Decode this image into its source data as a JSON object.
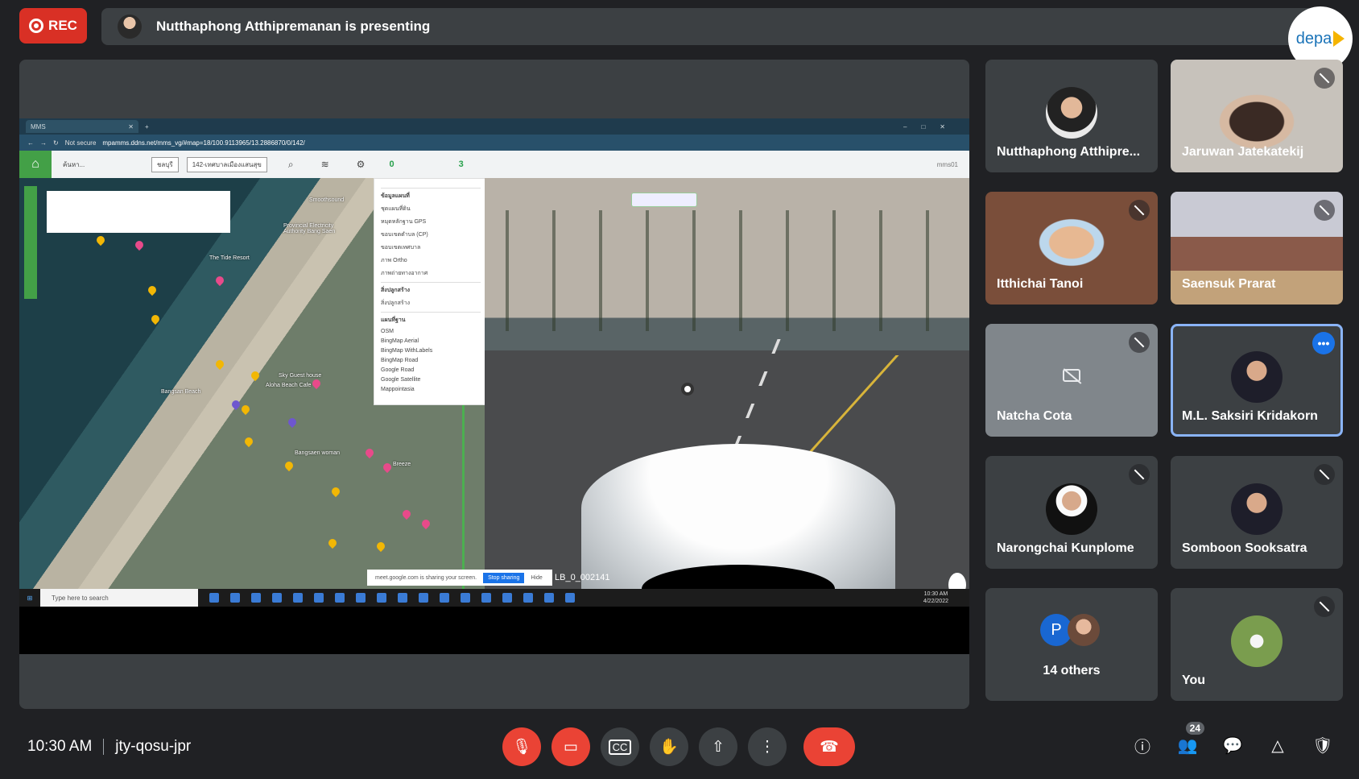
{
  "recording": {
    "label": "REC"
  },
  "presenter_banner": {
    "text": "Nutthaphong Atthipremanan is presenting"
  },
  "logo": {
    "text": "depa"
  },
  "shared_screen": {
    "browser": {
      "tab_title": "MMS",
      "url_prefix": "Not secure",
      "url": "mpamms.ddns.net/mms_vg/#map=18/100.9113965/13.2886870/0/142/"
    },
    "app": {
      "search_placeholder": "ค้นหา...",
      "filter1": "ชลบุรี",
      "filter2": "142-เทศบาลเมืองแสนสุข",
      "stat1_value": "0",
      "stat2_value": "3",
      "user": "mms01"
    },
    "map_labels": [
      "Smoothsound",
      "The Tide Resort",
      "Provincial Electricity Authority Bang Saen",
      "Aloha Beach Cafe",
      "Bangsan Beach",
      "Sky Guest house",
      "Bangsaen woman",
      "Breeze"
    ],
    "layers_panel": {
      "section1": "ข้อมูลแผนที่",
      "items1": [
        "ชุดแผนที่ดิน",
        "หมุดหลักฐาน GPS",
        "ขอบเขตตำบล (CP)",
        "ขอบเขตเทศบาล",
        "ภาพ Ortho",
        "ภาพถ่ายทางอากาศ"
      ],
      "section2": "สิ่งปลูกสร้าง",
      "items2": [
        "สิ่งปลูกสร้าง"
      ],
      "section3": "แผนที่ฐาน",
      "items3": [
        "OSM",
        "BingMap Aerial",
        "BingMap WithLabels",
        "BingMap Road",
        "Google Road",
        "Google Satellite",
        "Mappointasia"
      ]
    },
    "share_bar": {
      "text": "meet.google.com is sharing your screen.",
      "stop": "Stop sharing",
      "hide": "Hide"
    },
    "image_id": "LB_0_002141",
    "taskbar": {
      "search": "Type here to search",
      "time": "10:30 AM",
      "date": "4/22/2022"
    }
  },
  "participants": [
    {
      "name": "Nutthaphong Atthipre...",
      "muted": false
    },
    {
      "name": "Jaruwan Jatekatekij",
      "muted": true
    },
    {
      "name": "Itthichai Tanoi",
      "muted": true
    },
    {
      "name": "Saensuk Prarat",
      "muted": true
    },
    {
      "name": "Natcha Cota",
      "muted": true
    },
    {
      "name": "M.L. Saksiri Kridakorn",
      "muted": false
    },
    {
      "name": "Narongchai Kunplome",
      "muted": true
    },
    {
      "name": "Somboon Sooksatra",
      "muted": true
    },
    {
      "name": "14 others",
      "initial": "P"
    },
    {
      "name": "You",
      "muted": true
    }
  ],
  "meeting": {
    "time": "10:30 AM",
    "code": "jty-qosu-jpr"
  },
  "people_count": "24",
  "colors": {
    "background": "#202124",
    "tile": "#3c4043",
    "danger": "#ea4335",
    "accent": "#1a73e8"
  },
  "icons": [
    "mic-off-icon",
    "camera-off-icon",
    "captions-icon",
    "raise-hand-icon",
    "present-icon",
    "more-options-icon",
    "end-call-icon",
    "info-icon",
    "people-icon",
    "chat-icon",
    "activities-icon",
    "host-controls-icon"
  ]
}
